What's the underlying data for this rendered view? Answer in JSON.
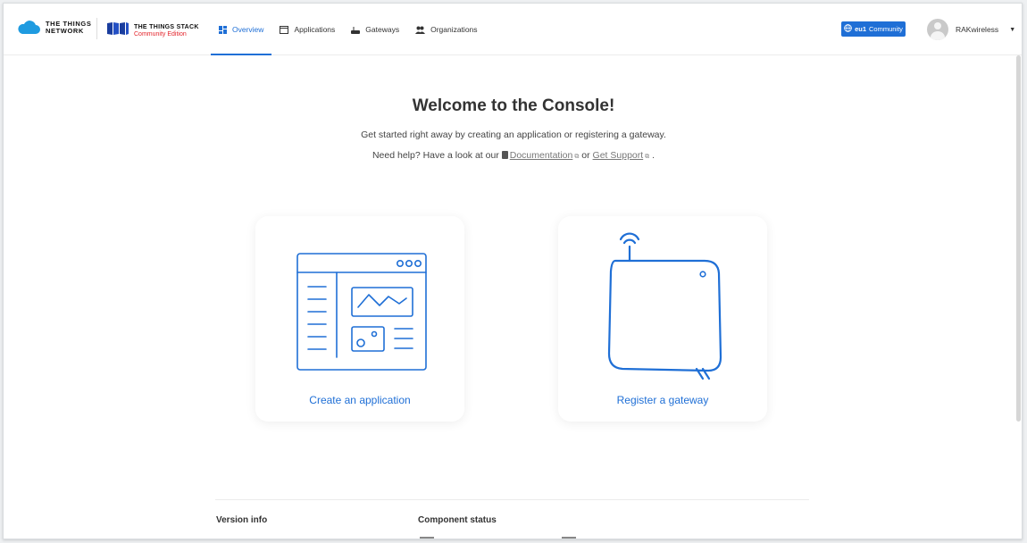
{
  "header": {
    "ttn_logo_text": [
      "THE THINGS",
      "NETWORK"
    ],
    "tts_logo_text": "THE THINGS STACK",
    "tts_edition": "Community Edition",
    "nav": [
      {
        "label": "Overview",
        "icon": "grid-icon",
        "active": true
      },
      {
        "label": "Applications",
        "icon": "window-icon",
        "active": false
      },
      {
        "label": "Gateways",
        "icon": "router-icon",
        "active": false
      },
      {
        "label": "Organizations",
        "icon": "people-icon",
        "active": false
      }
    ],
    "cluster": {
      "region": "eu1",
      "label": "Community"
    },
    "user": {
      "name": "RAKwireless"
    }
  },
  "main": {
    "title": "Welcome to the Console!",
    "subtitle": "Get started right away by creating an application or registering a gateway.",
    "help_prefix": "Need help? Have a look at our",
    "help_doc_link": "Documentation",
    "help_or": "or",
    "help_support_link": "Get Support",
    "help_suffix": "."
  },
  "cards": {
    "create_app": "Create an application",
    "register_gateway": "Register a gateway"
  },
  "footer": {
    "version_info": "Version info",
    "component_status": "Component status"
  },
  "colors": {
    "accent": "#1f6fd6",
    "brand_red": "#e3242b"
  }
}
